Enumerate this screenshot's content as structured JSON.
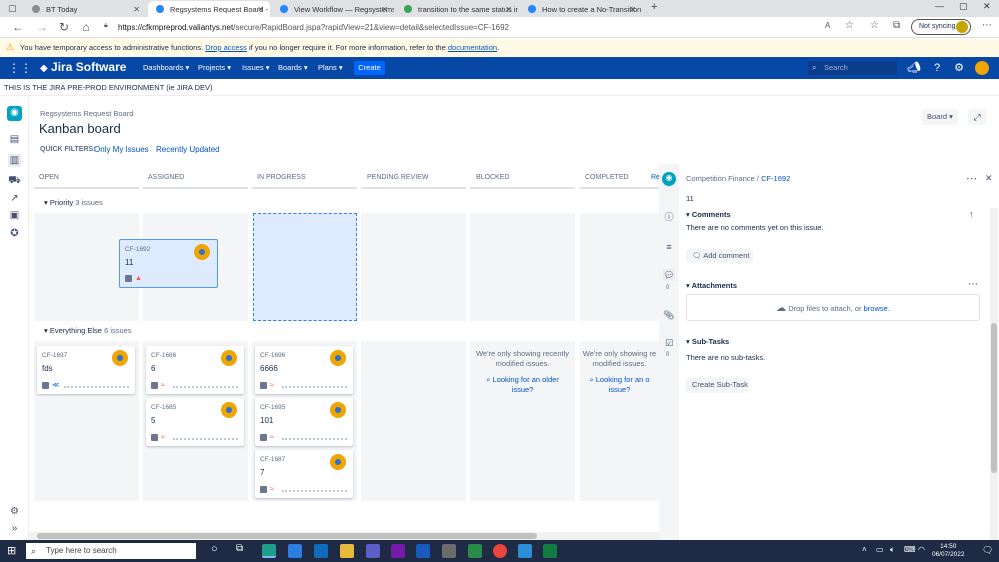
{
  "browser": {
    "tabs": [
      {
        "title": "BT Today",
        "color": "#8c8c8c",
        "active": false
      },
      {
        "title": "Regsystems Request Board - Agi",
        "color": "#2684ff",
        "active": true
      },
      {
        "title": "View Workflow — Regsystems R",
        "color": "#2684ff",
        "active": false
      },
      {
        "title": "transition to the same status in j",
        "color": "#34a853",
        "active": false
      },
      {
        "title": "How to create a No-Transition Tr",
        "color": "#2684ff",
        "active": false
      }
    ],
    "url_host": "https://cfkmpreprod.valiantys.net",
    "url_path": "/secure/RapidBoard.jspa?rapidView=21&view=detail&selectedIssue=CF-1692",
    "sync_label": "Not syncing"
  },
  "banner": {
    "text1": "You have temporary access to administrative functions. ",
    "link1": "Drop access",
    "text2": " if you no longer require it. For more information, refer to the ",
    "link2": "documentation",
    "text3": "."
  },
  "nav": {
    "logo": "Jira Software",
    "menus": [
      "Dashboards",
      "Projects",
      "Issues",
      "Boards",
      "Plans"
    ],
    "create": "Create",
    "search_placeholder": "Search"
  },
  "env_text": "THIS IS THE JIRA PRE-PROD ENVIRONMENT (ie JIRA DEV)",
  "board": {
    "project": "Regsystems Request Board",
    "title": "Kanban board",
    "quick_filters_label": "QUICK FILTERS:",
    "quick_filters": [
      "Only My Issues",
      "Recently Updated"
    ],
    "view_button": "Board",
    "columns": [
      "OPEN",
      "ASSIGNED",
      "IN PROGRESS",
      "PENDING REVIEW",
      "BLOCKED",
      "COMPLETED",
      "Re"
    ],
    "swimlanes": [
      {
        "name": "Priority",
        "count": "3 issues"
      },
      {
        "name": "Everything Else",
        "count": "6 issues"
      }
    ],
    "cards": [
      {
        "key": "CF-1692",
        "summary": "11",
        "priority": "high"
      },
      {
        "key": "CF-1697",
        "summary": "fds",
        "priority": "low"
      },
      {
        "key": "CF-1686",
        "summary": "6",
        "priority": "medium"
      },
      {
        "key": "CF-1685",
        "summary": "5",
        "priority": "medium"
      },
      {
        "key": "CF-1696",
        "summary": "6666",
        "priority": "medium"
      },
      {
        "key": "CF-1695",
        "summary": "101",
        "priority": "medium"
      },
      {
        "key": "CF-1687",
        "summary": "7",
        "priority": "medium"
      }
    ],
    "empty_msg_1": "We're only showing recently",
    "empty_msg_2": "modified issues.",
    "empty_link_1": "Looking for an older",
    "empty_link_2": "issue?",
    "empty_msg_c1": "We're only showing re",
    "empty_msg_c2": "modified issues.",
    "empty_link_c1": "Looking for an o",
    "empty_link_c2": "issue?"
  },
  "detail": {
    "project": "Competition Finance",
    "issue_key": "CF-1692",
    "summary": "11",
    "comments_title": "Comments",
    "comments_empty": "There are no comments yet on this issue.",
    "add_comment": "Add comment",
    "comment_count": "0",
    "attachments_title": "Attachments",
    "drop_text": "Drop files to attach, or ",
    "browse": "browse.",
    "subtasks_title": "Sub-Tasks",
    "subtasks_empty": "There are no sub-tasks.",
    "subtask_count": "0",
    "create_subtask": "Create Sub-Task"
  },
  "taskbar": {
    "search_placeholder": "Type here to search",
    "time": "14:50",
    "date": "06/07/2022"
  }
}
